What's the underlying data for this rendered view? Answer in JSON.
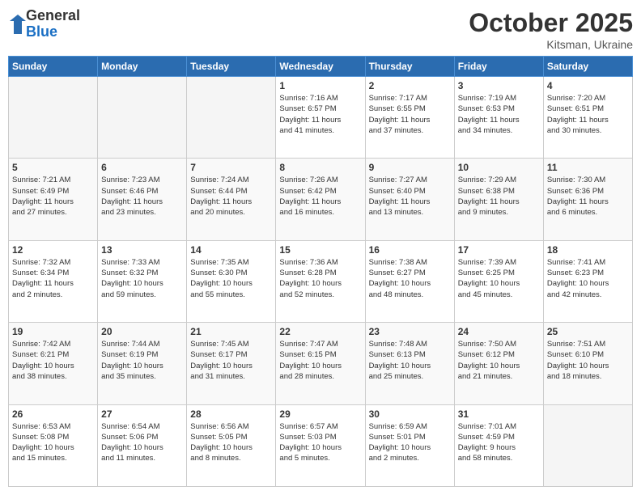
{
  "logo": {
    "general": "General",
    "blue": "Blue"
  },
  "header": {
    "month": "October 2025",
    "location": "Kitsman, Ukraine"
  },
  "weekdays": [
    "Sunday",
    "Monday",
    "Tuesday",
    "Wednesday",
    "Thursday",
    "Friday",
    "Saturday"
  ],
  "weeks": [
    [
      {
        "day": "",
        "info": ""
      },
      {
        "day": "",
        "info": ""
      },
      {
        "day": "",
        "info": ""
      },
      {
        "day": "1",
        "info": "Sunrise: 7:16 AM\nSunset: 6:57 PM\nDaylight: 11 hours\nand 41 minutes."
      },
      {
        "day": "2",
        "info": "Sunrise: 7:17 AM\nSunset: 6:55 PM\nDaylight: 11 hours\nand 37 minutes."
      },
      {
        "day": "3",
        "info": "Sunrise: 7:19 AM\nSunset: 6:53 PM\nDaylight: 11 hours\nand 34 minutes."
      },
      {
        "day": "4",
        "info": "Sunrise: 7:20 AM\nSunset: 6:51 PM\nDaylight: 11 hours\nand 30 minutes."
      }
    ],
    [
      {
        "day": "5",
        "info": "Sunrise: 7:21 AM\nSunset: 6:49 PM\nDaylight: 11 hours\nand 27 minutes."
      },
      {
        "day": "6",
        "info": "Sunrise: 7:23 AM\nSunset: 6:46 PM\nDaylight: 11 hours\nand 23 minutes."
      },
      {
        "day": "7",
        "info": "Sunrise: 7:24 AM\nSunset: 6:44 PM\nDaylight: 11 hours\nand 20 minutes."
      },
      {
        "day": "8",
        "info": "Sunrise: 7:26 AM\nSunset: 6:42 PM\nDaylight: 11 hours\nand 16 minutes."
      },
      {
        "day": "9",
        "info": "Sunrise: 7:27 AM\nSunset: 6:40 PM\nDaylight: 11 hours\nand 13 minutes."
      },
      {
        "day": "10",
        "info": "Sunrise: 7:29 AM\nSunset: 6:38 PM\nDaylight: 11 hours\nand 9 minutes."
      },
      {
        "day": "11",
        "info": "Sunrise: 7:30 AM\nSunset: 6:36 PM\nDaylight: 11 hours\nand 6 minutes."
      }
    ],
    [
      {
        "day": "12",
        "info": "Sunrise: 7:32 AM\nSunset: 6:34 PM\nDaylight: 11 hours\nand 2 minutes."
      },
      {
        "day": "13",
        "info": "Sunrise: 7:33 AM\nSunset: 6:32 PM\nDaylight: 10 hours\nand 59 minutes."
      },
      {
        "day": "14",
        "info": "Sunrise: 7:35 AM\nSunset: 6:30 PM\nDaylight: 10 hours\nand 55 minutes."
      },
      {
        "day": "15",
        "info": "Sunrise: 7:36 AM\nSunset: 6:28 PM\nDaylight: 10 hours\nand 52 minutes."
      },
      {
        "day": "16",
        "info": "Sunrise: 7:38 AM\nSunset: 6:27 PM\nDaylight: 10 hours\nand 48 minutes."
      },
      {
        "day": "17",
        "info": "Sunrise: 7:39 AM\nSunset: 6:25 PM\nDaylight: 10 hours\nand 45 minutes."
      },
      {
        "day": "18",
        "info": "Sunrise: 7:41 AM\nSunset: 6:23 PM\nDaylight: 10 hours\nand 42 minutes."
      }
    ],
    [
      {
        "day": "19",
        "info": "Sunrise: 7:42 AM\nSunset: 6:21 PM\nDaylight: 10 hours\nand 38 minutes."
      },
      {
        "day": "20",
        "info": "Sunrise: 7:44 AM\nSunset: 6:19 PM\nDaylight: 10 hours\nand 35 minutes."
      },
      {
        "day": "21",
        "info": "Sunrise: 7:45 AM\nSunset: 6:17 PM\nDaylight: 10 hours\nand 31 minutes."
      },
      {
        "day": "22",
        "info": "Sunrise: 7:47 AM\nSunset: 6:15 PM\nDaylight: 10 hours\nand 28 minutes."
      },
      {
        "day": "23",
        "info": "Sunrise: 7:48 AM\nSunset: 6:13 PM\nDaylight: 10 hours\nand 25 minutes."
      },
      {
        "day": "24",
        "info": "Sunrise: 7:50 AM\nSunset: 6:12 PM\nDaylight: 10 hours\nand 21 minutes."
      },
      {
        "day": "25",
        "info": "Sunrise: 7:51 AM\nSunset: 6:10 PM\nDaylight: 10 hours\nand 18 minutes."
      }
    ],
    [
      {
        "day": "26",
        "info": "Sunrise: 6:53 AM\nSunset: 5:08 PM\nDaylight: 10 hours\nand 15 minutes."
      },
      {
        "day": "27",
        "info": "Sunrise: 6:54 AM\nSunset: 5:06 PM\nDaylight: 10 hours\nand 11 minutes."
      },
      {
        "day": "28",
        "info": "Sunrise: 6:56 AM\nSunset: 5:05 PM\nDaylight: 10 hours\nand 8 minutes."
      },
      {
        "day": "29",
        "info": "Sunrise: 6:57 AM\nSunset: 5:03 PM\nDaylight: 10 hours\nand 5 minutes."
      },
      {
        "day": "30",
        "info": "Sunrise: 6:59 AM\nSunset: 5:01 PM\nDaylight: 10 hours\nand 2 minutes."
      },
      {
        "day": "31",
        "info": "Sunrise: 7:01 AM\nSunset: 4:59 PM\nDaylight: 9 hours\nand 58 minutes."
      },
      {
        "day": "",
        "info": ""
      }
    ]
  ]
}
